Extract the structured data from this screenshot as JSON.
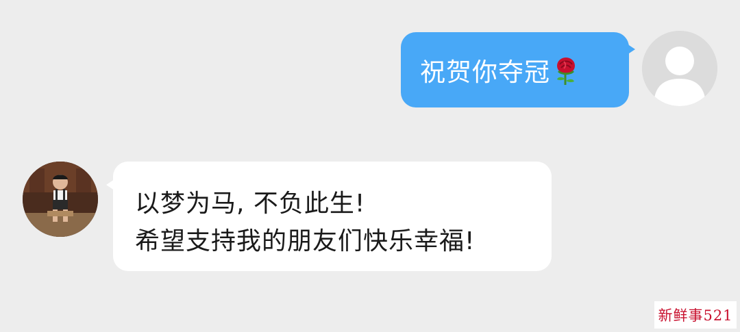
{
  "chat": {
    "outgoing": {
      "text": "祝贺你夺冠",
      "emoji_icon": "rose-icon"
    },
    "incoming": {
      "lines": [
        "以梦为马, 不负此生!",
        "希望支持我的朋友们快乐幸福!"
      ]
    }
  },
  "watermark": {
    "text": "新鲜事521"
  },
  "colors": {
    "background": "#ededed",
    "outgoing_bubble": "#48a8f7",
    "incoming_bubble": "#ffffff",
    "watermark_text": "#c8102e"
  }
}
